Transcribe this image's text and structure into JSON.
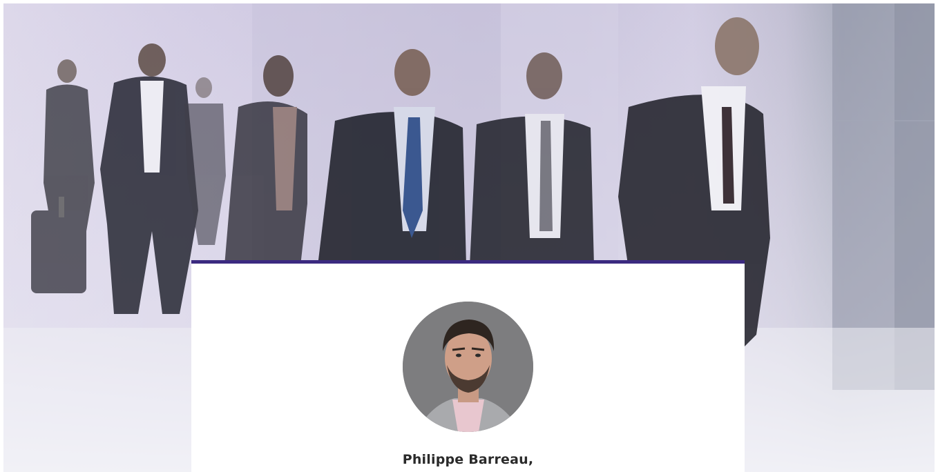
{
  "hero": {
    "image": "business-people-walking-photo"
  },
  "profile": {
    "avatar_icon": "portrait-photo",
    "name": "Philippe Barreau,"
  },
  "colors": {
    "card_accent": "#3b2a80",
    "hero_tint": "#cfc9e1",
    "name_text": "#2a2a2a"
  }
}
